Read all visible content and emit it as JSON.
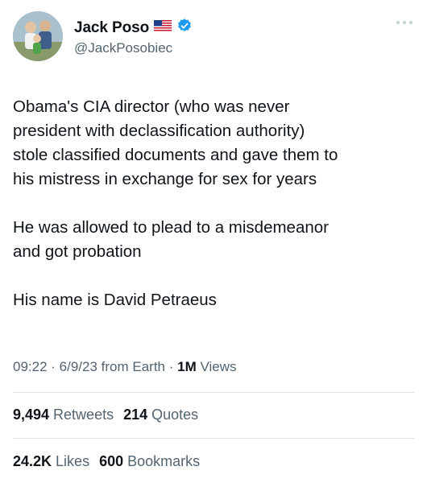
{
  "author": {
    "display_name": "Jack Poso",
    "flag": "🇺🇸",
    "handle": "@JackPosobiec"
  },
  "tweet": {
    "paragraphs": [
      "Obama's CIA director (who was never\npresident with declassification authority)\nstole classified documents and gave them to\nhis mistress in exchange for sex for years",
      "He was allowed to plead to a misdemeanor\nand got probation",
      "His name is David Petraeus"
    ]
  },
  "meta": {
    "time": "09:22",
    "sep1": " · ",
    "date": "6/9/23",
    "source": " from Earth",
    "sep2": " · ",
    "views_count": "1M",
    "views_label": " Views"
  },
  "stats": {
    "retweets_count": "9,494",
    "retweets_label": "Retweets",
    "quotes_count": "214",
    "quotes_label": "Quotes",
    "likes_count": "24.2K",
    "likes_label": "Likes",
    "bookmarks_count": "600",
    "bookmarks_label": "Bookmarks"
  },
  "colors": {
    "verified": "#1d9bf0",
    "secondary": "#536471",
    "divider": "#dfe3e6"
  },
  "icons": [
    "verified-badge-icon",
    "more-options-icon",
    "us-flag-icon"
  ]
}
